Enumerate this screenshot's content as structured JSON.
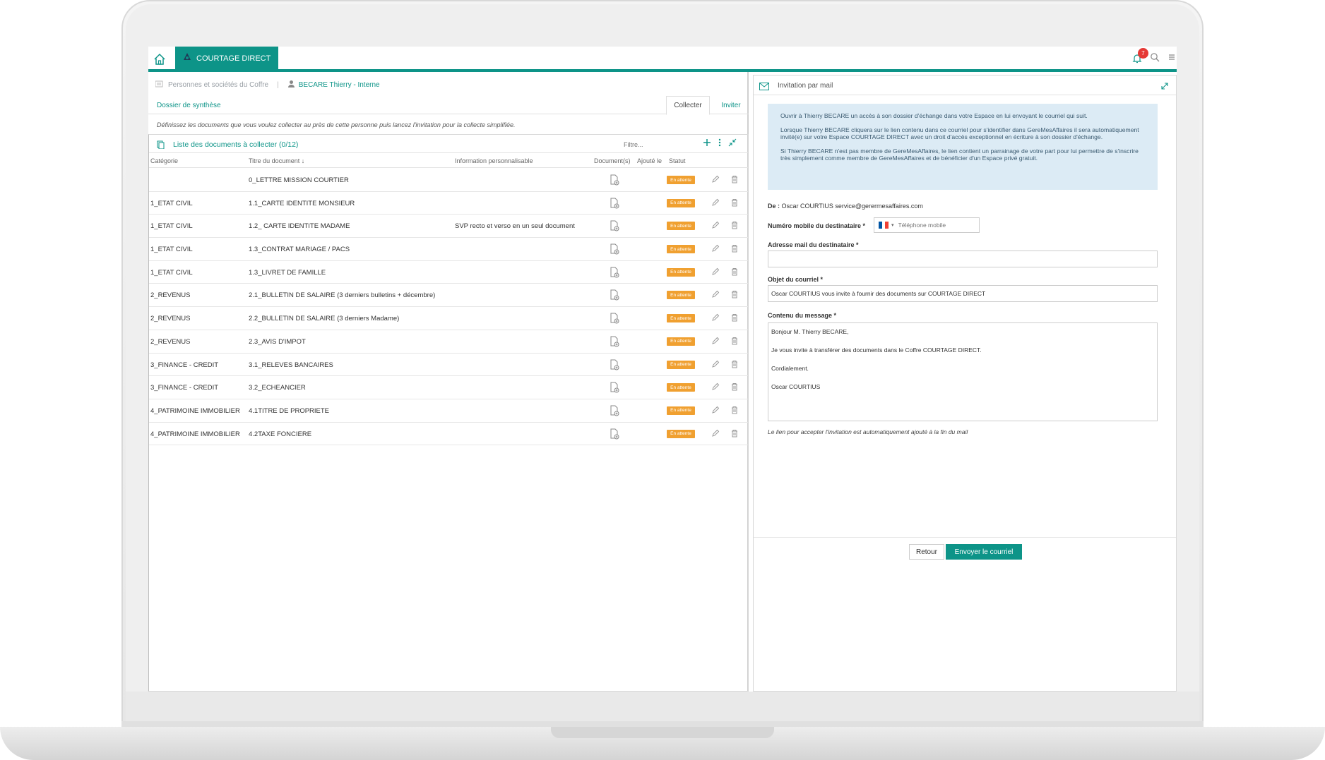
{
  "app": {
    "brand": "COURTAGE DIRECT",
    "notification_count": "7",
    "accent_color": "#0d9488"
  },
  "breadcrumb": {
    "root": "Personnes et sociétés du Coffre",
    "person": "BECARE Thierry - Interne"
  },
  "subtabs": {
    "synthesis": "Dossier de synthèse",
    "collect": "Collecter",
    "invite": "Inviter"
  },
  "intro": "Définissez les documents que vous voulez collecter au près de cette personne puis lancez l'invitation pour la collecte simplifiée.",
  "list": {
    "title": "Liste des documents à collecter (0/12)",
    "filter_placeholder": "Filtre...",
    "columns": {
      "category": "Catégorie",
      "title": "Titre du document ↓",
      "info": "Information personnalisable",
      "docs": "Document(s)",
      "added": "Ajouté le",
      "status": "Statut"
    },
    "rows": [
      {
        "category": "",
        "title": "0_LETTRE MISSION COURTIER",
        "info": "",
        "status": "En attente"
      },
      {
        "category": "1_ETAT CIVIL",
        "title": "1.1_CARTE IDENTITE MONSIEUR",
        "info": "",
        "status": "En attente"
      },
      {
        "category": "1_ETAT CIVIL",
        "title": "1.2_ CARTE IDENTITE MADAME",
        "info": "SVP recto et verso en un seul document",
        "status": "En attente"
      },
      {
        "category": "1_ETAT CIVIL",
        "title": "1.3_CONTRAT MARIAGE / PACS",
        "info": "",
        "status": "En attente"
      },
      {
        "category": "1_ETAT CIVIL",
        "title": "1.3_LIVRET DE FAMILLE",
        "info": "",
        "status": "En attente"
      },
      {
        "category": "2_REVENUS",
        "title": "2.1_BULLETIN DE SALAIRE (3 derniers bulletins + décembre)",
        "info": "",
        "status": "En attente"
      },
      {
        "category": "2_REVENUS",
        "title": "2.2_BULLETIN DE SALAIRE (3 derniers Madame)",
        "info": "",
        "status": "En attente"
      },
      {
        "category": "2_REVENUS",
        "title": "2.3_AVIS D'IMPOT",
        "info": "",
        "status": "En attente"
      },
      {
        "category": "3_FINANCE - CREDIT",
        "title": "3.1_RELEVES BANCAIRES",
        "info": "",
        "status": "En attente"
      },
      {
        "category": "3_FINANCE - CREDIT",
        "title": "3.2_ECHEANCIER",
        "info": "",
        "status": "En attente"
      },
      {
        "category": "4_PATRIMOINE IMMOBILIER",
        "title": "4.1TITRE DE PROPRIETE",
        "info": "",
        "status": "En attente"
      },
      {
        "category": "4_PATRIMOINE IMMOBILIER",
        "title": "4.2TAXE FONCIERE",
        "info": "",
        "status": "En attente"
      }
    ]
  },
  "invite": {
    "title": "Invitation par mail",
    "info_p1": "Ouvrir à Thierry BECARE un accès à son dossier d'échange dans votre Espace en lui envoyant le courriel qui suit.",
    "info_p2": "Lorsque Thierry BECARE cliquera sur le lien contenu dans ce courriel pour s'identifier dans GereMesAffaires il sera automatiquement invité(e) sur votre Espace COURTAGE DIRECT avec un droit d'accès exceptionnel en écriture à son dossier d'échange.",
    "info_p3": "Si Thierry BECARE n'est pas membre de GereMesAffaires, le lien contient un parrainage de votre part pour lui permettre de s'inscrire très simplement comme membre de GereMesAffaires et de bénéficier d'un Espace privé gratuit.",
    "from_label": "De :",
    "from_value": "Oscar COURTIUS service@gerermesaffaires.com",
    "mobile_label": "Numéro mobile du destinataire *",
    "mobile_placeholder": "Téléphone mobile",
    "email_label": "Adresse mail du destinataire *",
    "email_value": "",
    "subject_label": "Objet du courriel *",
    "subject_value": "Oscar COURTIUS vous invite à fournir des documents sur COURTAGE DIRECT",
    "message_label": "Contenu du message *",
    "message_value": "Bonjour M. Thierry BECARE,\n\nJe vous invite à transférer des documents dans le Coffre COURTAGE DIRECT.\n\nCordialement.\n\nOscar COURTIUS",
    "footnote": "Le lien pour accepter l'invitation est automatiquement ajouté à la fin du mail",
    "back_label": "Retour",
    "send_label": "Envoyer le courriel"
  }
}
